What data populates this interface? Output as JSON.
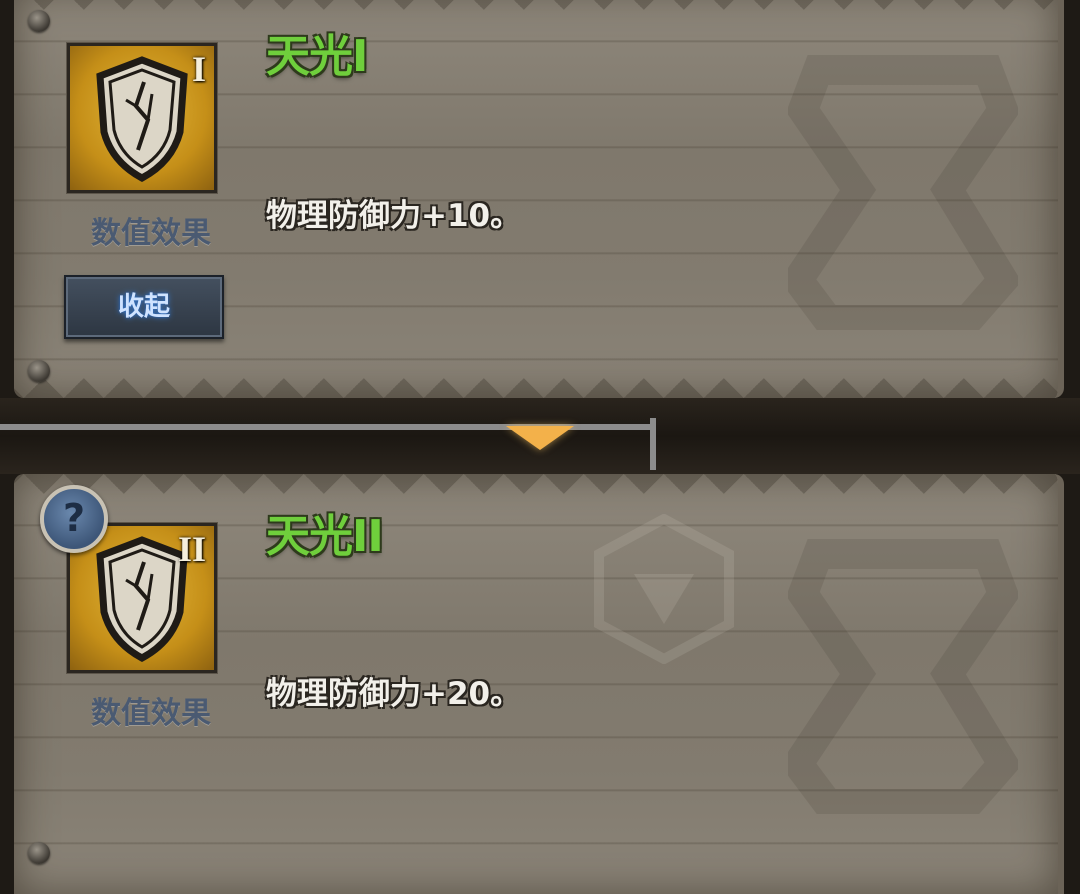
{
  "skills": [
    {
      "name": "天光I",
      "rank": "I",
      "effect_label": "数值效果",
      "description": "物理防御力+10。",
      "icon": "shield-icon"
    },
    {
      "name": "天光II",
      "rank": "II",
      "effect_label": "数值效果",
      "description": "物理防御力+20。",
      "icon": "shield-icon"
    }
  ],
  "collapse_button": {
    "label": "收起"
  },
  "help_button": {
    "label": "?",
    "icon": "question-icon"
  },
  "divider": {
    "icon": "down-arrow-icon",
    "color": "#f3b14a"
  },
  "colors": {
    "skill_name": "#6fcf3c",
    "icon_background": "#c58f18",
    "panel": "#857e72"
  }
}
